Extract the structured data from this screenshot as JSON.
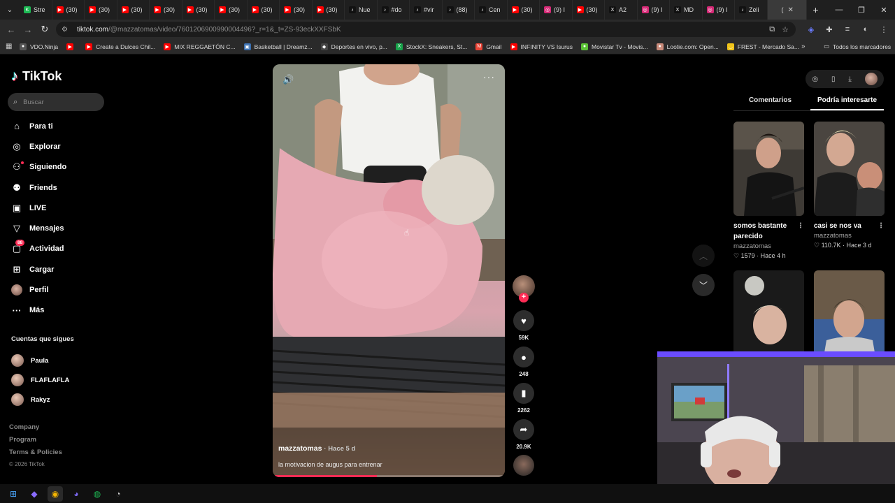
{
  "browser": {
    "tabs": [
      {
        "label": "Stre",
        "fav": "#1db954",
        "glyph": "K"
      },
      {
        "label": "(30)",
        "fav": "#ff0000",
        "glyph": "▶"
      },
      {
        "label": "(30)",
        "fav": "#ff0000",
        "glyph": "▶"
      },
      {
        "label": "(30)",
        "fav": "#ff0000",
        "glyph": "▶"
      },
      {
        "label": "(30)",
        "fav": "#ff0000",
        "glyph": "▶"
      },
      {
        "label": "(30)",
        "fav": "#ff0000",
        "glyph": "▶"
      },
      {
        "label": "(30)",
        "fav": "#ff0000",
        "glyph": "▶"
      },
      {
        "label": "(30)",
        "fav": "#ff0000",
        "glyph": "▶"
      },
      {
        "label": "(30)",
        "fav": "#ff0000",
        "glyph": "▶"
      },
      {
        "label": "(30)",
        "fav": "#ff0000",
        "glyph": "▶"
      },
      {
        "label": "Nue",
        "fav": "#111111",
        "glyph": "♪"
      },
      {
        "label": "#do",
        "fav": "#111111",
        "glyph": "♪"
      },
      {
        "label": "#vir",
        "fav": "#111111",
        "glyph": "♪"
      },
      {
        "label": "(88)",
        "fav": "#111111",
        "glyph": "♪"
      },
      {
        "label": "Cen",
        "fav": "#111111",
        "glyph": "♪"
      },
      {
        "label": "(30)",
        "fav": "#ff0000",
        "glyph": "▶"
      },
      {
        "label": "(9) I",
        "fav": "#d62976",
        "glyph": "◎"
      },
      {
        "label": "(30)",
        "fav": "#ff0000",
        "glyph": "▶"
      },
      {
        "label": "A2",
        "fav": "#111111",
        "glyph": "X"
      },
      {
        "label": "(9) I",
        "fav": "#d62976",
        "glyph": "◎"
      },
      {
        "label": "MD",
        "fav": "#111111",
        "glyph": "X"
      },
      {
        "label": "(9) I",
        "fav": "#d62976",
        "glyph": "◎"
      },
      {
        "label": "Zeli",
        "fav": "#111111",
        "glyph": "♪"
      },
      {
        "label": "(",
        "fav": "#3a3a3a",
        "glyph": "",
        "active": true
      }
    ],
    "url_host": "tiktok.com",
    "url_path": "/@mazzatomas/video/7601206900990004496?_r=1&_t=ZS-93eckXXFSbK",
    "bookmarks": [
      {
        "label": "VDO.Ninja",
        "color": "#555555",
        "glyph": "●"
      },
      {
        "label": "",
        "color": "#ff0000",
        "glyph": "▶"
      },
      {
        "label": "Create a Dulces Chil...",
        "color": "#ff0000",
        "glyph": "▶"
      },
      {
        "label": "MIX REGGAETÓN C...",
        "color": "#ff0000",
        "glyph": "▶"
      },
      {
        "label": "Basketball | Dreamz...",
        "color": "#3a6fb0",
        "glyph": "▣"
      },
      {
        "label": "Deportes en vivo, p...",
        "color": "#444444",
        "glyph": "◆"
      },
      {
        "label": "StockX: Sneakers, St...",
        "color": "#17a34a",
        "glyph": "X"
      },
      {
        "label": "Gmail",
        "color": "#ea4335",
        "glyph": "M"
      },
      {
        "label": "INFINITY VS Isurus",
        "color": "#ff0000",
        "glyph": "▶"
      },
      {
        "label": "Movistar Tv - Movis...",
        "color": "#5bc236",
        "glyph": "●"
      },
      {
        "label": "Lootie.com: Open...",
        "color": "#c98a7a",
        "glyph": "●"
      },
      {
        "label": "FREST - Mercado Sa...",
        "color": "#f0c419",
        "glyph": "◡"
      }
    ],
    "all_bookmarks": "Todos los marcadores"
  },
  "tiktok": {
    "logo": "TikTok",
    "search_placeholder": "Buscar",
    "nav": [
      {
        "label": "Para ti",
        "icon": "⌂",
        "name": "home-icon"
      },
      {
        "label": "Explorar",
        "icon": "◎",
        "name": "compass-icon"
      },
      {
        "label": "Siguiendo",
        "icon": "⚇",
        "name": "following-icon",
        "dot": true
      },
      {
        "label": "Friends",
        "icon": "⚉",
        "name": "friends-icon"
      },
      {
        "label": "LIVE",
        "icon": "▣",
        "name": "live-icon"
      },
      {
        "label": "Mensajes",
        "icon": "▽",
        "name": "messages-icon"
      },
      {
        "label": "Actividad",
        "icon": "▢",
        "name": "activity-icon",
        "badge": "88"
      },
      {
        "label": "Cargar",
        "icon": "⊞",
        "name": "upload-icon"
      },
      {
        "label": "Perfil",
        "icon": "",
        "name": "profile-avatar",
        "avatar": true
      },
      {
        "label": "Más",
        "icon": "···",
        "name": "more-icon"
      }
    ],
    "following_heading": "Cuentas que sigues",
    "following": [
      "Paula",
      "FLAFLAFLA",
      "Rakyz"
    ],
    "footer": [
      "Company",
      "Program",
      "Terms & Policies"
    ],
    "copyright": "© 2026 TikTok"
  },
  "video": {
    "author": "mazzatomas",
    "ago": "Hace 5 d",
    "description": "la motivacion de augus para entrenar",
    "progress": 0.45,
    "likes": "59K",
    "comments": "248",
    "saves": "2262",
    "shares": "20.9K"
  },
  "right_panel": {
    "tabs": [
      "Comentarios",
      "Podría interesarte"
    ],
    "cards": [
      {
        "title": "somos bastante parecido",
        "author": "mazzatomas",
        "likes": "1579",
        "ago": "Hace 4 h"
      },
      {
        "title": "casi se nos va",
        "author": "mazzatomas",
        "likes": "110.7K",
        "ago": "Hace 3 d"
      },
      {
        "title": "",
        "author": "",
        "likes": "",
        "ago": ""
      },
      {
        "title": "",
        "author": "",
        "likes": "",
        "ago": ""
      }
    ]
  },
  "taskbar": [
    {
      "name": "windows-start-icon",
      "glyph": "⊞",
      "color": "#4aa8ff"
    },
    {
      "name": "copilot-icon",
      "glyph": "◆",
      "color": "#8a6cff"
    },
    {
      "name": "chrome-icon",
      "glyph": "◉",
      "color": "#f4b400",
      "active": true
    },
    {
      "name": "messenger-icon",
      "glyph": "◕",
      "color": "#7b68ee"
    },
    {
      "name": "spotify-icon",
      "glyph": "◍",
      "color": "#1db954"
    },
    {
      "name": "obs-icon",
      "glyph": "◔",
      "color": "#cccccc"
    }
  ]
}
